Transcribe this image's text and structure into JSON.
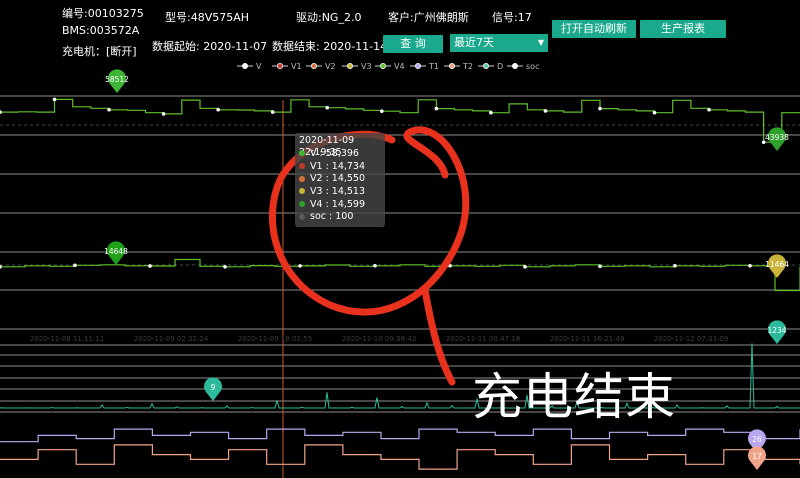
{
  "header": {
    "id_label": "编号:00103275",
    "bms_label": "BMS:003572A",
    "charger_label": "充电机：[断开]",
    "model_label": "型号:48V575AH",
    "drive_label": "驱动:NG_2.0",
    "customer_label": "客户:广州佛朗斯",
    "signal_label": "信号:17",
    "start_label": "数据起始: 2020-11-07",
    "end_label": "数据结束: 2020-11-14",
    "query_button": "查 询",
    "range_select": "最近7天",
    "auto_refresh_button": "打开自动刷新",
    "report_button": "生产报表"
  },
  "legend": [
    {
      "name": "V",
      "color": "#ffffff"
    },
    {
      "name": "V1",
      "color": "#c0392b"
    },
    {
      "name": "V2",
      "color": "#d4703a"
    },
    {
      "name": "V3",
      "color": "#c9b43a"
    },
    {
      "name": "V4",
      "color": "#5fbf2a"
    },
    {
      "name": "T1",
      "color": "#b9a6f0"
    },
    {
      "name": "T2",
      "color": "#f0a48a"
    },
    {
      "name": "D",
      "color": "#5ec6a8"
    },
    {
      "name": "soc",
      "color": "#ffffff"
    }
  ],
  "tooltip": {
    "time": "2020-11-09 22:19:35",
    "rows": [
      {
        "label": "V : 58,396",
        "color": "#3fb536"
      },
      {
        "label": "V1 : 14,734",
        "color": "#c0392b"
      },
      {
        "label": "V2 : 14,550",
        "color": "#d4703a"
      },
      {
        "label": "V3 : 14,513",
        "color": "#c9b43a"
      },
      {
        "label": "V4 : 14,599",
        "color": "#2fa02a"
      },
      {
        "label": "soc : 100",
        "color": "#5b5b5b"
      }
    ]
  },
  "annotation": "充电结束",
  "chart_data": {
    "type": "line",
    "marker_labels": {
      "V_max": "58512",
      "V_min": "43938",
      "V4_max": "14648",
      "V4_min": "11464",
      "D_max": "1234",
      "D_min": "9",
      "T1_end": "26",
      "T2_end": "17"
    },
    "x_axis_labels": [
      "2020-11-08 11:11:11",
      "2020-11-09 02:32:24",
      "2020-11-09 18:02:55",
      "2020-11-10 09:38:42",
      "2020-11-11 00:47:18",
      "2020-11-11 16:21:49",
      "2020-11-12 07:33:09"
    ],
    "series": [
      {
        "name": "V",
        "color": "#5fbf2a",
        "values": [
          54200,
          54300,
          54200,
          58512,
          56000,
          55500,
          55000,
          54800,
          54000,
          53600,
          58300,
          55500,
          55000,
          54900,
          54600,
          54200,
          58400,
          56000,
          55700,
          55300,
          54800,
          54500,
          54000,
          58400,
          55400,
          55000,
          54600,
          54000,
          57000,
          55000,
          54600,
          54200,
          58200,
          55400,
          55000,
          54600,
          54000,
          58200,
          55500,
          55000,
          54600,
          54200,
          43938,
          54000,
          54000
        ]
      },
      {
        "name": "V4",
        "color": "#5fbf2a",
        "values": [
          13900,
          14000,
          13950,
          14050,
          14100,
          14000,
          13980,
          14648,
          13950,
          13900,
          14020,
          13950,
          13990,
          14080,
          13950,
          14000,
          14100,
          13950,
          14000,
          13950,
          14050,
          13900,
          14000,
          14100,
          13950,
          14000,
          13900,
          14000,
          13950,
          14050,
          14000,
          11464,
          13900
        ]
      },
      {
        "name": "D",
        "color": "#2dba9c",
        "values": [
          3,
          2,
          9,
          3,
          60,
          12,
          80,
          25,
          8,
          40,
          10,
          150,
          20,
          300,
          15,
          200,
          30,
          100,
          50,
          180,
          20,
          250,
          40,
          120,
          10,
          90,
          20,
          60,
          5,
          40,
          1234,
          30,
          10
        ]
      },
      {
        "name": "T1",
        "color": "#b9a6f0",
        "values": [
          22,
          24,
          23,
          26,
          24,
          25,
          23,
          26,
          24,
          25,
          23,
          26,
          25,
          24,
          26,
          23,
          25,
          24,
          26,
          25,
          23,
          26
        ]
      },
      {
        "name": "T2",
        "color": "#f0a48a",
        "values": [
          18,
          20,
          17,
          21,
          19,
          18,
          20,
          17,
          21,
          19,
          18,
          16,
          20,
          19,
          17,
          21,
          18,
          19,
          17,
          20,
          18,
          17
        ]
      }
    ]
  }
}
